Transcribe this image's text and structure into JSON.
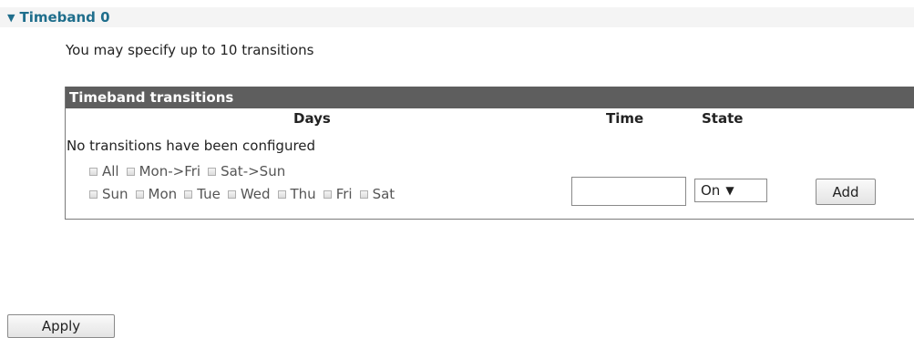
{
  "section": {
    "title": "Timeband 0",
    "expanded": true,
    "subtitle": "You may specify up to 10 transitions"
  },
  "transitions_table": {
    "title": "Timeband transitions",
    "columns": [
      "Days",
      "Time",
      "State"
    ],
    "empty_message": "No transitions have been configured"
  },
  "new_transition": {
    "day_groups": [
      "All",
      "Mon->Fri",
      "Sat->Sun"
    ],
    "days": [
      "Sun",
      "Mon",
      "Tue",
      "Wed",
      "Thu",
      "Fri",
      "Sat"
    ],
    "time_value": "",
    "state_selected": "On",
    "state_arrow": "▼",
    "add_label": "Add"
  },
  "footer": {
    "apply_label": "Apply"
  },
  "colors": {
    "link_blue": "#1f6e8c",
    "table_header_bg": "#5e5e5e"
  },
  "icons": {
    "caret": "caret-down-icon",
    "select_arrow": "select-arrow-icon"
  }
}
